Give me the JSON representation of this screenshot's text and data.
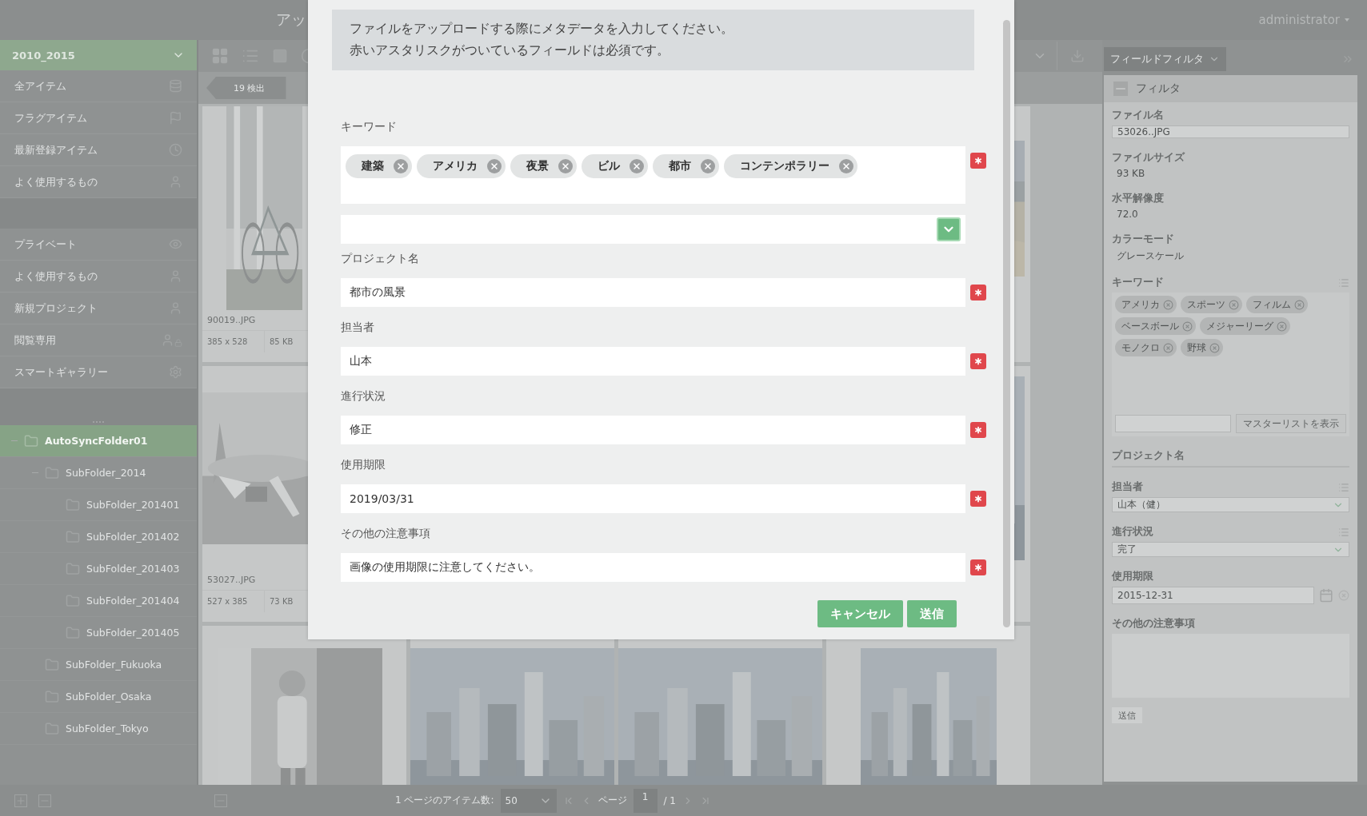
{
  "top_bar": {
    "title": "アッ",
    "user": "administrator"
  },
  "sidebar": {
    "header": "2010_2015",
    "sections": [
      [
        {
          "label": "全アイテム"
        },
        {
          "label": "フラグアイテム"
        },
        {
          "label": "最新登録アイテム"
        },
        {
          "label": "よく使用するもの"
        }
      ],
      [
        {
          "label": "プライベート"
        },
        {
          "label": "よく使用するもの"
        },
        {
          "label": "新規プロジェクト"
        },
        {
          "label": "閲覧専用"
        },
        {
          "label": "スマートギャラリー"
        }
      ]
    ],
    "tree": [
      {
        "label": "AutoSyncFolder01",
        "selected": true,
        "expanded": true,
        "children": [
          {
            "label": "SubFolder_2014",
            "selected": false,
            "expanded": true,
            "children": [
              {
                "label": "SubFolder_201401",
                "selected": false
              },
              {
                "label": "SubFolder_201402",
                "selected": false
              },
              {
                "label": "SubFolder_201403",
                "selected": false
              },
              {
                "label": "SubFolder_201404",
                "selected": false
              },
              {
                "label": "SubFolder_201405",
                "selected": false
              }
            ]
          },
          {
            "label": "SubFolder_Fukuoka",
            "selected": false
          },
          {
            "label": "SubFolder_Osaka",
            "selected": false
          },
          {
            "label": "SubFolder_Tokyo",
            "selected": false
          }
        ]
      }
    ]
  },
  "results": {
    "count": "19 検出"
  },
  "thumbnails": [
    {
      "name": "90019..JPG",
      "dims": "385 x 528",
      "size": "85 KB"
    },
    {
      "name": "53027..JPG",
      "dims": "527 x 385",
      "size": "73 KB"
    }
  ],
  "pager": {
    "per_page_label": "1 ページのアイテム数:",
    "per_page": "50",
    "page_label": "ページ",
    "page": "1",
    "total": "/ 1"
  },
  "filter_panel": {
    "dropdown": "フィールドフィルタ",
    "title": "フィルタ",
    "fields": [
      {
        "kind": "input",
        "label": "ファイル名",
        "value": "53026..JPG"
      },
      {
        "kind": "text",
        "label": "ファイルサイズ",
        "value": "93 KB"
      },
      {
        "kind": "text",
        "label": "水平解像度",
        "value": "72.0"
      },
      {
        "kind": "text",
        "label": "カラーモード",
        "value": "グレースケール"
      },
      {
        "kind": "tags",
        "label": "キーワード",
        "tags": [
          "アメリカ",
          "スポーツ",
          "フィルム",
          "ベースボール",
          "メジャーリーグ",
          "モノクロ",
          "野球"
        ],
        "button": "マスターリストを表示"
      },
      {
        "kind": "input",
        "label": "プロジェクト名"
      },
      {
        "kind": "select",
        "label": "担当者",
        "value": "山本（健）"
      },
      {
        "kind": "select",
        "label": "進行状況",
        "value": "完了"
      },
      {
        "kind": "date",
        "label": "使用期限",
        "value": "2015-12-31"
      },
      {
        "kind": "textarea",
        "label": "その他の注意事項"
      }
    ],
    "submit": "送信"
  },
  "modal": {
    "message": [
      "ファイルをアップロードする際にメタデータを入力してください。",
      "赤いアスタリスクがついているフィールドは必須です。"
    ],
    "fields": [
      {
        "kind": "tags",
        "label": "キーワード",
        "tags": [
          "建築",
          "アメリカ",
          "夜景",
          "ビル",
          "都市",
          "コンテンポラリー"
        ],
        "required": true
      },
      {
        "kind": "input",
        "label": "プロジェクト名",
        "value": "都市の風景",
        "required": true
      },
      {
        "kind": "input",
        "label": "担当者",
        "value": "山本",
        "required": true
      },
      {
        "kind": "input",
        "label": "進行状況",
        "value": "修正",
        "required": true
      },
      {
        "kind": "input",
        "label": "使用期限",
        "value": "2019/03/31",
        "required": true
      },
      {
        "kind": "input",
        "label": "その他の注意事項",
        "value": "画像の使用期限に注意してください。",
        "required": true
      }
    ],
    "buttons": [
      {
        "label": "キャンセル"
      },
      {
        "label": "送信"
      }
    ]
  }
}
